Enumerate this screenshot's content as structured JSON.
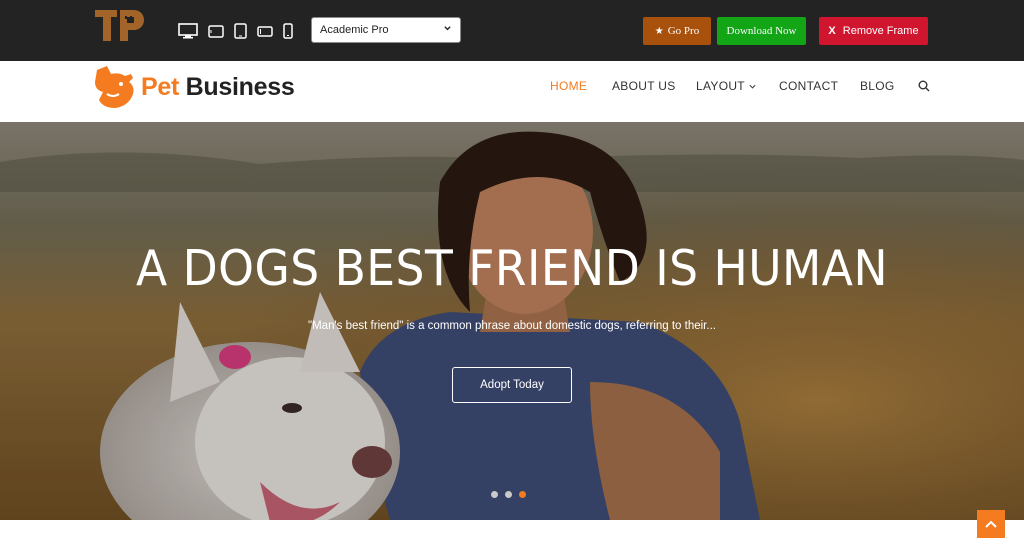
{
  "preview_bar": {
    "logo_text": "TP",
    "devices": [
      {
        "name": "desktop-icon",
        "label": "desktop"
      },
      {
        "name": "tablet-landscape-icon",
        "label": "tablet landscape"
      },
      {
        "name": "tablet-portrait-icon",
        "label": "tablet portrait"
      },
      {
        "name": "mobile-landscape-icon",
        "label": "mobile landscape"
      },
      {
        "name": "mobile-portrait-icon",
        "label": "mobile portrait"
      }
    ],
    "theme_select": {
      "value": "Academic Pro"
    },
    "go_pro_label": "Go Pro",
    "download_label": "Download Now",
    "remove_x": "X",
    "remove_label": "Remove Frame",
    "colors": {
      "bar": "#232323",
      "go_pro": "#a8510d",
      "download": "#12a516",
      "remove": "#d0162f"
    }
  },
  "site": {
    "brand": {
      "pet": "Pet",
      "business": "Business",
      "accent": "#f47b20"
    },
    "nav": [
      {
        "label": "HOME",
        "active": true
      },
      {
        "label": "ABOUT US",
        "active": false
      },
      {
        "label": "LAYOUT",
        "active": false,
        "has_dropdown": true
      },
      {
        "label": "CONTACT",
        "active": false
      },
      {
        "label": "BLOG",
        "active": false
      }
    ]
  },
  "hero": {
    "title": "A DOGS BEST FRIEND IS HUMAN",
    "subtitle": "\"Man's best friend\" is a common phrase about domestic dogs, referring to their...",
    "cta": "Adopt Today",
    "slides": 3,
    "active_slide": 3
  }
}
